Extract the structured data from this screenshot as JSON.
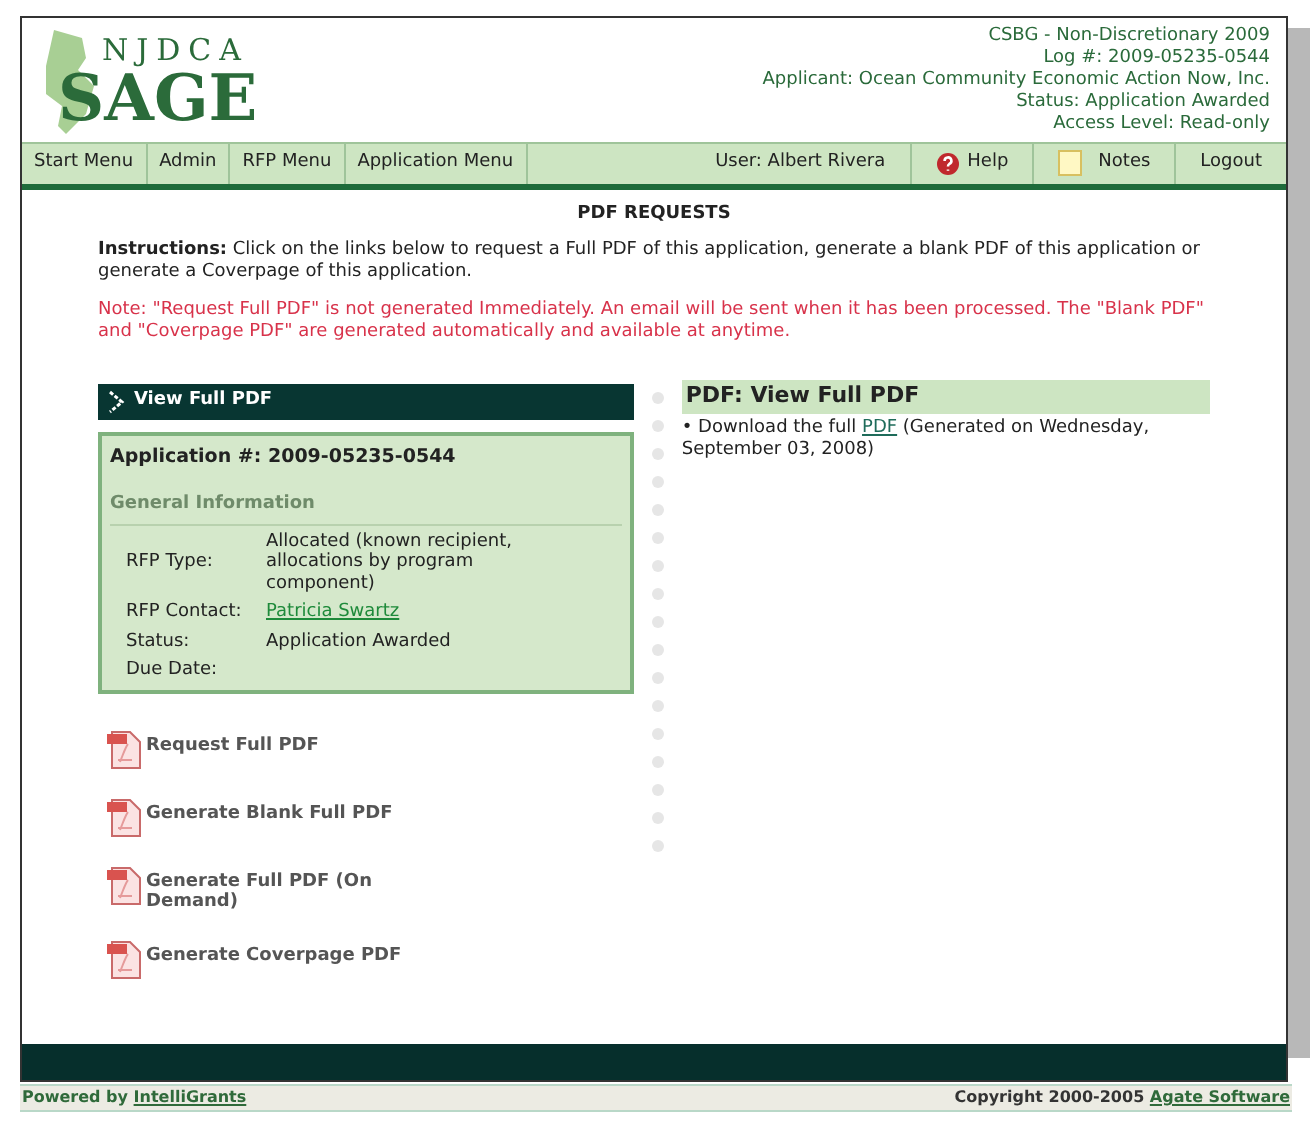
{
  "logo": {
    "top": "NJDCA",
    "main": "SAGE"
  },
  "header_info": [
    "CSBG - Non-Discretionary 2009",
    "Log #: 2009-05235-0544",
    "Applicant: Ocean Community Economic Action Now, Inc.",
    "Status: Application Awarded",
    "Access Level: Read-only"
  ],
  "nav_left": [
    "Start Menu",
    "Admin",
    "RFP Menu",
    "Application Menu"
  ],
  "nav_right": [
    {
      "kind": "text",
      "label": "User: Albert Rivera"
    },
    {
      "kind": "help",
      "label": "Help"
    },
    {
      "kind": "notes",
      "label": "Notes"
    },
    {
      "kind": "plain",
      "label": "Logout"
    }
  ],
  "page_title": "PDF REQUESTS",
  "instructions": "**Instructions:**  Click on the links below to request a Full PDF of this application, generate a blank PDF of this application or generate a Coverpage of this application.",
  "note": "Note: \"Request Full PDF\" is not generated Immediately. An email will be sent when it has been processed. The \"Blank PDF\" and \"Coverpage PDF\" are generated automatically and available at anytime.",
  "section_bar": "View Full PDF",
  "application": {
    "title": "Application #: 2009-05235-0544",
    "subtitle": "General Information",
    "fields": [
      {
        "kind": "text",
        "label": "RFP Type:",
        "value": "Allocated (known recipient, allocations by program component)"
      },
      {
        "kind": "link",
        "label": "RFP Contact:",
        "value": "Patricia Swartz"
      },
      {
        "kind": "text",
        "label": "Status:",
        "value": "Application Awarded"
      },
      {
        "label": "Due Date:"
      }
    ]
  },
  "actions": [
    "Request Full PDF",
    "Generate Blank Full PDF",
    "Generate Full PDF (On Demand)",
    "Generate Coverpage PDF"
  ],
  "right_panel": {
    "title": "PDF: View Full PDF",
    "bullet": "•",
    "before": "Download the full ",
    "link": "PDF",
    "after": " (Generated on Wednesday, September 03, 2008)"
  },
  "footer": {
    "left_text": "Powered by ",
    "left_link": "IntelliGrants",
    "right_text": "Copyright 2000-2005 ",
    "right_link": "Agate Software"
  }
}
